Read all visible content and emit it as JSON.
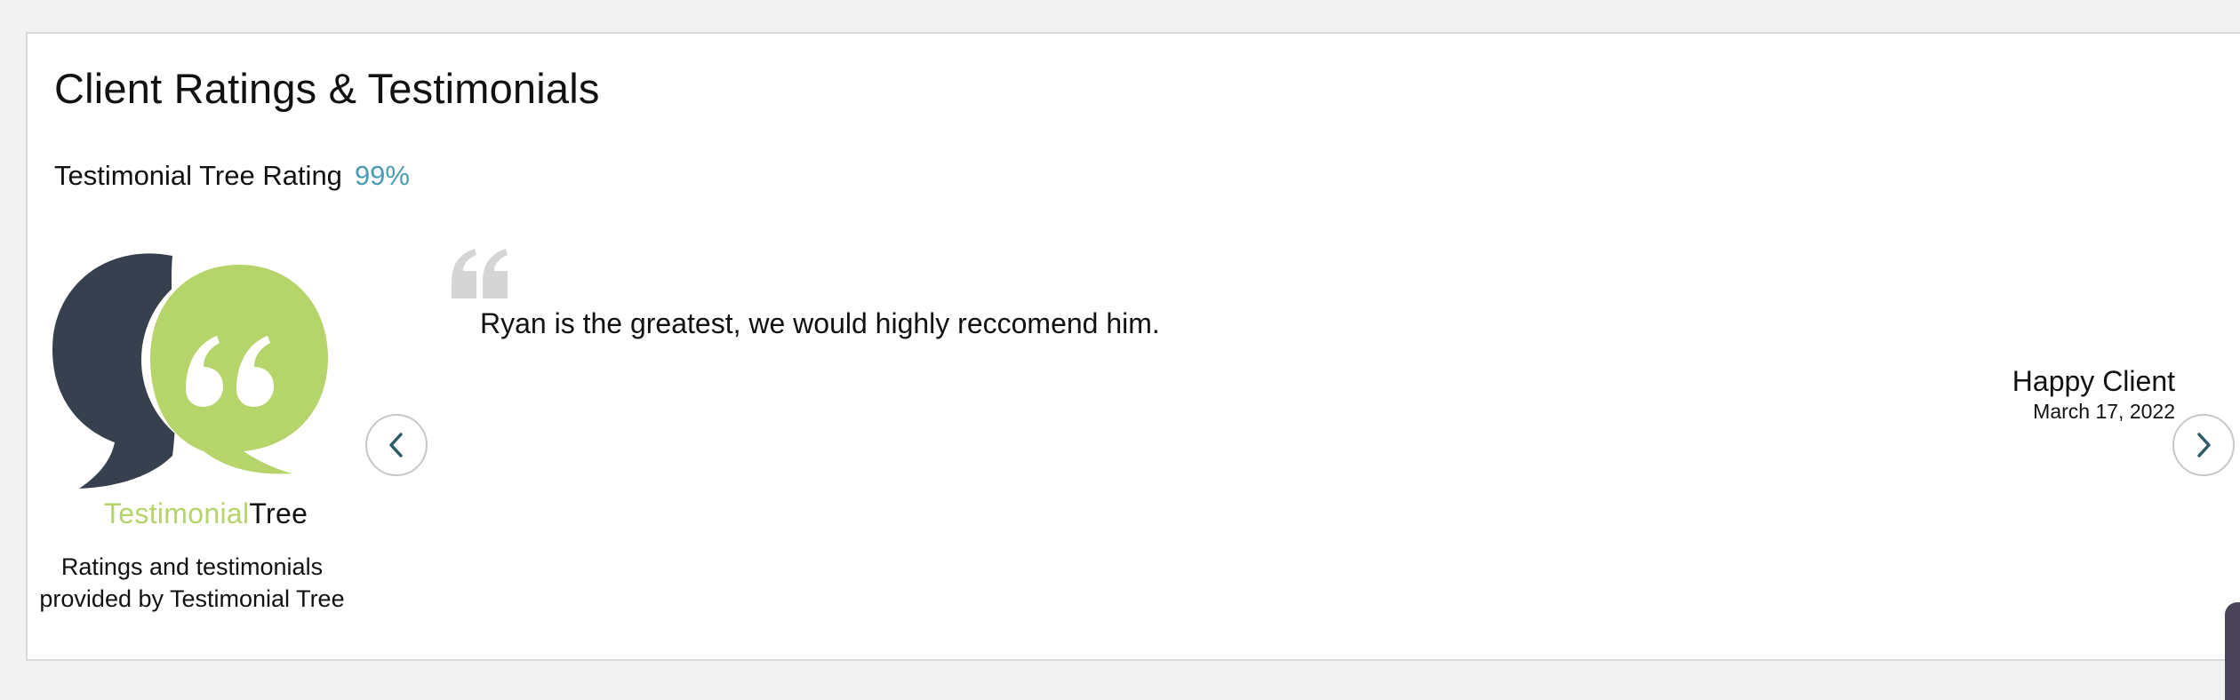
{
  "header": {
    "title": "Client Ratings & Testimonials"
  },
  "rating": {
    "label": "Testimonial Tree Rating",
    "value": "99%"
  },
  "brand": {
    "part1": "Testimonial",
    "part2": "Tree",
    "provided_text": "Ratings and testimonials provided by Testimonial Tree"
  },
  "testimonial": {
    "text": "Ryan is the greatest, we would highly reccomend him.",
    "author": "Happy Client",
    "date": "March 17, 2022"
  },
  "icons": {
    "logo": "speech-bubbles-logo",
    "quote": "quote-icon",
    "prev": "chevron-left-icon",
    "next": "chevron-right-icon"
  },
  "colors": {
    "accent_blue": "#4a9bb3",
    "brand_green": "#b5d46a",
    "bubble_dark": "#36404e",
    "quote_gray": "#d5d5d5",
    "chevron": "#2f5b68"
  }
}
